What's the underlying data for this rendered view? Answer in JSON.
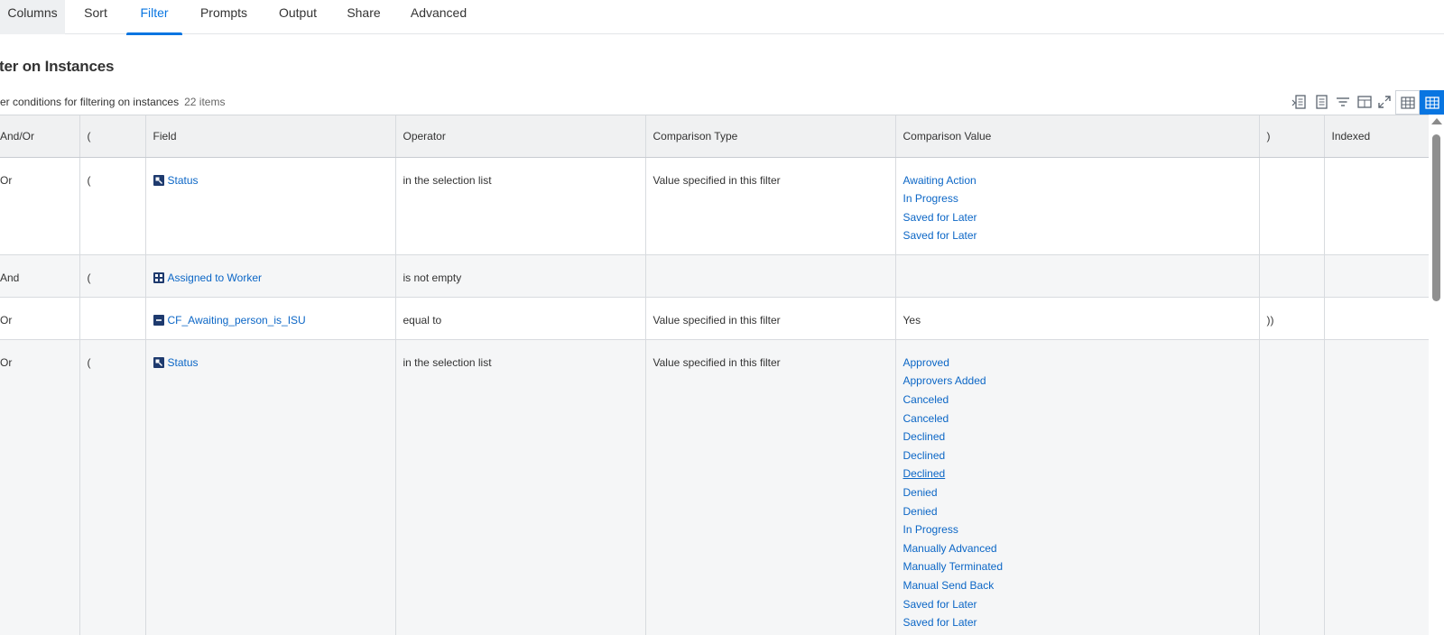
{
  "tabs": [
    {
      "label": "Columns"
    },
    {
      "label": "Sort"
    },
    {
      "label": "Filter"
    },
    {
      "label": "Prompts"
    },
    {
      "label": "Output"
    },
    {
      "label": "Share"
    },
    {
      "label": "Advanced"
    }
  ],
  "active_tab": "Filter",
  "section": {
    "title": "ilter on Instances",
    "subtitle": "lter conditions for filtering on instances",
    "count": "22 items"
  },
  "toolbar": {
    "icons": [
      "export-to-excel-icon",
      "export-to-pdf-icon",
      "filter-icon",
      "column-chooser-icon",
      "fullscreen-icon",
      "grid-view-icon",
      "table-view-icon"
    ],
    "accent": "#0875e1"
  },
  "table": {
    "headers": {
      "and_or": "And/Or",
      "open_paren": "(",
      "field": "Field",
      "operator": "Operator",
      "comparison_type": "Comparison Type",
      "comparison_value": "Comparison Value",
      "close_paren": ")",
      "indexed": "Indexed"
    },
    "rows": [
      {
        "and_or": "Or",
        "open_paren": "(",
        "field": "Status",
        "field_icon": "single-instance-icon",
        "operator": "in the selection list",
        "comparison_type": "Value specified in this filter",
        "comparison_values": [
          "Awaiting Action",
          "In Progress",
          "Saved for Later",
          "Saved for Later"
        ],
        "close_paren": "",
        "indexed": ""
      },
      {
        "and_or": "And",
        "open_paren": "(",
        "field": "Assigned to Worker",
        "field_icon": "multi-instance-icon",
        "operator": "is not empty",
        "comparison_type": "",
        "comparison_values": [],
        "close_paren": "",
        "indexed": ""
      },
      {
        "and_or": "Or",
        "open_paren": "",
        "field": "CF_Awaiting_person_is_ISU",
        "field_icon": "boolean-field-icon",
        "operator": "equal to",
        "comparison_type": "Value specified in this filter",
        "comparison_value_text": "Yes",
        "close_paren": "))",
        "indexed": ""
      },
      {
        "and_or": "Or",
        "open_paren": "(",
        "field": "Status",
        "field_icon": "single-instance-icon",
        "operator": "in the selection list",
        "comparison_type": "Value specified in this filter",
        "comparison_values": [
          "Approved",
          "Approvers Added",
          "Canceled",
          "Canceled",
          "Declined",
          "Declined",
          "Declined",
          "Denied",
          "Denied",
          "In Progress",
          "Manually Advanced",
          "Manually Terminated",
          "Manual Send Back",
          "Saved for Later",
          "Saved for Later"
        ],
        "close_paren": "",
        "indexed": ""
      }
    ]
  },
  "colors": {
    "link": "#0b66c6",
    "header_bg": "#f0f1f2",
    "alt_row_bg": "#f5f6f7",
    "icon_dark": "#1e3a6e"
  }
}
